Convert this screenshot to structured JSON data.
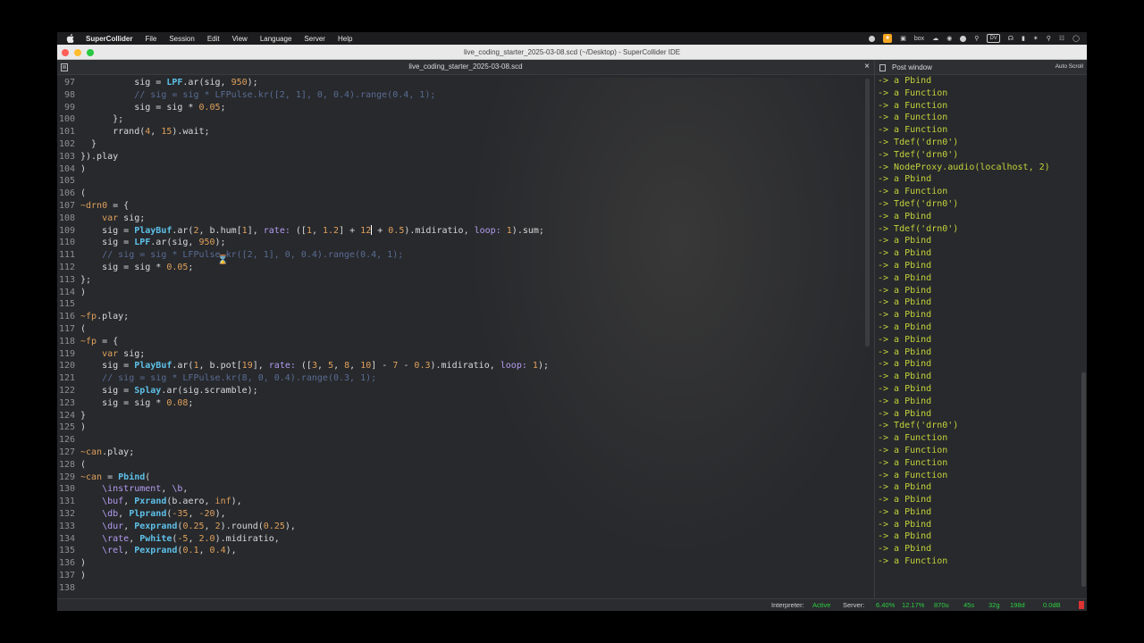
{
  "menubar": {
    "app_name": "SuperCollider",
    "items": [
      "File",
      "Session",
      "Edit",
      "View",
      "Language",
      "Server",
      "Help"
    ],
    "status_box_label": "box",
    "status_dv_label": "DV"
  },
  "window": {
    "title": "live_coding_starter_2025-03-08.scd (~/Desktop) - SuperCollider IDE"
  },
  "editor": {
    "tab_title": "live_coding_starter_2025-03-08.scd",
    "close_label": "×",
    "lines": [
      {
        "n": "97",
        "html": "          sig = <span class='cls'>LPF</span>.ar(sig, <span class='num'>950</span>);"
      },
      {
        "n": "98",
        "html": "          <span class='cmt'>// sig = sig * LFPulse.kr([2, 1], 0, 0.4).range(0.4, 1);</span>"
      },
      {
        "n": "99",
        "html": "          sig = sig * <span class='num'>0.05</span>;"
      },
      {
        "n": "100",
        "html": "      };"
      },
      {
        "n": "101",
        "html": "      rrand(<span class='num'>4</span>, <span class='num'>15</span>).wait;"
      },
      {
        "n": "102",
        "html": "  }"
      },
      {
        "n": "103",
        "html": "}).play"
      },
      {
        "n": "104",
        "html": ")"
      },
      {
        "n": "105",
        "html": ""
      },
      {
        "n": "106",
        "html": "("
      },
      {
        "n": "107",
        "html": "<span class='env'>~drn0</span> = {"
      },
      {
        "n": "108",
        "html": "    <span class='kw'>var</span> sig;"
      },
      {
        "n": "109",
        "html": "    sig = <span class='cls'>PlayBuf</span>.ar(<span class='num'>2</span>, b.hum[<span class='num'>1</span>], <span class='sym'>rate:</span> ([<span class='num'>1</span>, <span class='num'>1.2</span>] + <span class='num'>12</span><span class='cursor-bar'></span> + <span class='num'>0.5</span>).midiratio, <span class='sym'>loop:</span> <span class='num'>1</span>).sum;"
      },
      {
        "n": "110",
        "html": "    sig = <span class='cls'>LPF</span>.ar(sig, <span class='num'>950</span>);"
      },
      {
        "n": "111",
        "html": "    <span class='cmt'>// sig = sig * LFPulse.kr([2, 1], 0, 0.4).range(0.4, 1);</span>"
      },
      {
        "n": "112",
        "html": "    sig = sig * <span class='num'>0.05</span>;"
      },
      {
        "n": "113",
        "html": "};"
      },
      {
        "n": "114",
        "html": ")"
      },
      {
        "n": "115",
        "html": ""
      },
      {
        "n": "116",
        "html": "<span class='env'>~fp</span>.play;"
      },
      {
        "n": "117",
        "html": "("
      },
      {
        "n": "118",
        "html": "<span class='env'>~fp</span> = {"
      },
      {
        "n": "119",
        "html": "    <span class='kw'>var</span> sig;"
      },
      {
        "n": "120",
        "html": "    sig = <span class='cls'>PlayBuf</span>.ar(<span class='num'>1</span>, b.pot[<span class='num'>19</span>], <span class='sym'>rate:</span> ([<span class='num'>3</span>, <span class='num'>5</span>, <span class='num'>8</span>, <span class='num'>10</span>] - <span class='num'>7</span> - <span class='num'>0.3</span>).midiratio, <span class='sym'>loop:</span> <span class='num'>1</span>);"
      },
      {
        "n": "121",
        "html": "    <span class='cmt'>// sig = sig * LFPulse.kr(8, 0, 0.4).range(0.3, 1);</span>"
      },
      {
        "n": "122",
        "html": "    sig = <span class='cls'>Splay</span>.ar(sig.scramble);"
      },
      {
        "n": "123",
        "html": "    sig = sig * <span class='num'>0.08</span>;"
      },
      {
        "n": "124",
        "html": "}"
      },
      {
        "n": "125",
        "html": ")"
      },
      {
        "n": "126",
        "html": ""
      },
      {
        "n": "127",
        "html": "<span class='env'>~can</span>.play;"
      },
      {
        "n": "128",
        "html": "("
      },
      {
        "n": "129",
        "html": "<span class='env'>~can</span> = <span class='cls'>Pbind</span>("
      },
      {
        "n": "130",
        "html": "    <span class='sym'>\\instrument</span>, <span class='sym'>\\b</span>,"
      },
      {
        "n": "131",
        "html": "    <span class='sym'>\\buf</span>, <span class='cls'>Pxrand</span>(b.aero, <span class='kw'>inf</span>),"
      },
      {
        "n": "132",
        "html": "    <span class='sym'>\\db</span>, <span class='cls'>Plprand</span>(<span class='num'>-35</span>, <span class='num'>-20</span>),"
      },
      {
        "n": "133",
        "html": "    <span class='sym'>\\dur</span>, <span class='cls'>Pexprand</span>(<span class='num'>0.25</span>, <span class='num'>2</span>).round(<span class='num'>0.25</span>),"
      },
      {
        "n": "134",
        "html": "    <span class='sym'>\\rate</span>, <span class='cls'>Pwhite</span>(<span class='num'>-5</span>, <span class='num'>2.0</span>).midiratio,"
      },
      {
        "n": "135",
        "html": "    <span class='sym'>\\rel</span>, <span class='cls'>Pexprand</span>(<span class='num'>0.1</span>, <span class='num'>0.4</span>),"
      },
      {
        "n": "136",
        "html": ")"
      },
      {
        "n": "137",
        "html": ")"
      },
      {
        "n": "138",
        "html": ""
      }
    ]
  },
  "post": {
    "title": "Post window",
    "autoscroll_label": "Auto Scroll",
    "lines": [
      "-> a Pbind",
      "-> a Function",
      "-> a Function",
      "-> a Function",
      "-> a Function",
      "-> Tdef('drn0')",
      "-> Tdef('drn0')",
      "-> NodeProxy.audio(localhost, 2)",
      "-> a Pbind",
      "-> a Function",
      "-> Tdef('drn0')",
      "-> a Pbind",
      "-> Tdef('drn0')",
      "-> a Pbind",
      "-> a Pbind",
      "-> a Pbind",
      "-> a Pbind",
      "-> a Pbind",
      "-> a Pbind",
      "-> a Pbind",
      "-> a Pbind",
      "-> a Pbind",
      "-> a Pbind",
      "-> a Pbind",
      "-> a Pbind",
      "-> a Pbind",
      "-> a Pbind",
      "-> a Pbind",
      "-> Tdef('drn0')",
      "-> a Function",
      "-> a Function",
      "-> a Function",
      "-> a Function",
      "-> a Pbind",
      "-> a Pbind",
      "-> a Pbind",
      "-> a Pbind",
      "-> a Pbind",
      "-> a Pbind",
      "-> a Function"
    ]
  },
  "statusbar": {
    "interpreter_label": "Interpreter:",
    "interpreter_state": "Active",
    "server_label": "Server:",
    "avg_cpu": "6.40%",
    "peak_cpu": "12.17%",
    "ugens": "870u",
    "synths": "45s",
    "groups": "32g",
    "synthdefs": "198d",
    "volume": "0.0dB"
  },
  "colors": {
    "close": "#ff5f57",
    "minimize": "#febc2e",
    "maximize": "#28c840",
    "active": "#2ecc40",
    "post_text": "#c6d23a"
  }
}
